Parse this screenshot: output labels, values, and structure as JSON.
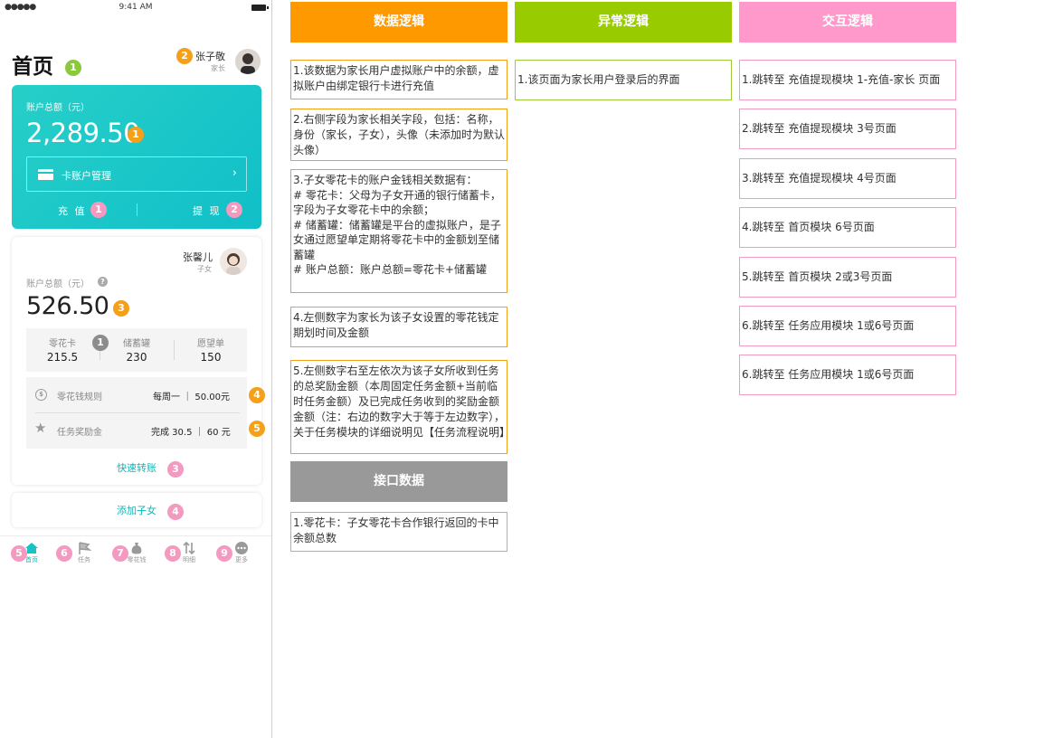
{
  "phone": {
    "status": {
      "time": "9:41 AM",
      "signal": "●●●●●"
    },
    "page_title": "首页",
    "parent": {
      "name": "张子敬",
      "role": "家长"
    },
    "main_card": {
      "label": "账户总额（元）",
      "amount": "2,289.50",
      "card_manage": "卡账户管理",
      "chevron": "›",
      "recharge": "充 值",
      "withdraw": "提 现"
    },
    "child_card": {
      "name": "张馨儿",
      "role": "子女",
      "label": "账户总额（元）",
      "help": "?",
      "amount": "526.50",
      "stats": [
        {
          "label": "零花卡",
          "value": "215.5"
        },
        {
          "label": "储蓄罐",
          "value": "230"
        },
        {
          "label": "愿望单",
          "value": "150"
        }
      ],
      "allowance_rule": {
        "label": "零花钱规则",
        "value": "每周一 ｜ 50.00元",
        "icon": "$"
      },
      "task_reward": {
        "label": "任务奖励金",
        "value": "完成 30.5 ｜ 60 元",
        "icon": "★"
      },
      "quick_transfer": "快速转账"
    },
    "add_child": "添加子女",
    "tabs": [
      {
        "label": "首页",
        "icon": "home-icon"
      },
      {
        "label": "任务",
        "icon": "flag-icon"
      },
      {
        "label": "零花钱",
        "icon": "money-bag-icon"
      },
      {
        "label": "明细",
        "icon": "transfer-icon"
      },
      {
        "label": "更多",
        "icon": "more-icon"
      }
    ],
    "badges": {
      "title": "1",
      "parent": "2",
      "main_amount": "1",
      "recharge": "1",
      "withdraw": "2",
      "child_amount": "3",
      "stats": "1",
      "allowance": "4",
      "task": "5",
      "transfer": "3",
      "add_child": "4",
      "tab_home": "5",
      "tab_task": "6",
      "tab_money": "7",
      "tab_detail": "8",
      "tab_more": "9"
    }
  },
  "columns": {
    "data_logic": {
      "header": "数据逻辑",
      "notes": [
        "1.该数据为家长用户虚拟账户中的余额，虚拟账户由绑定银行卡进行充值",
        "2.右侧字段为家长相关字段，包括：名称，身份（家长，子女），头像（未添加时为默认头像）",
        "3.子女零花卡的账户金钱相关数据有：\n # 零花卡：父母为子女开通的银行储蓄卡，字段为子女零花卡中的余额；\n # 储蓄罐：储蓄罐是平台的虚拟账户，是子女通过愿望单定期将零花卡中的金额划至储蓄罐\n # 账户总额：账户总额=零花卡+储蓄罐",
        "4.左侧数字为家长为该子女设置的零花钱定期划时间及金额",
        "5.左侧数字右至左依次为该子女所收到任务的总奖励金额（本周固定任务金额+当前临时任务金额）及已完成任务收到的奖励金额金额（注：右边的数字大于等于左边数字），关于任务模块的详细说明见【任务流程说明】"
      ]
    },
    "interface_data": {
      "header": "接口数据",
      "notes": [
        "1.零花卡：子女零花卡合作银行返回的卡中余额总数"
      ]
    },
    "exception_logic": {
      "header": "异常逻辑",
      "notes": [
        "1.该页面为家长用户登录后的界面"
      ]
    },
    "interaction_logic": {
      "header": "交互逻辑",
      "notes": [
        "1.跳转至 充值提现模块 1-充值-家长 页面",
        "2.跳转至 充值提现模块 3号页面",
        "3.跳转至 充值提现模块 4号页面",
        "4.跳转至 首页模块 6号页面",
        "5.跳转至 首页模块 2或3号页面",
        "6.跳转至 任务应用模块 1或6号页面",
        "6.跳转至 任务应用模块 1或6号页面"
      ]
    }
  },
  "colors": {
    "data_logic": "#ff9900",
    "exception_logic": "#99cc00",
    "interaction_logic": "#ff99cc",
    "interface_data": "#999999",
    "teal": "#14c4c6"
  }
}
